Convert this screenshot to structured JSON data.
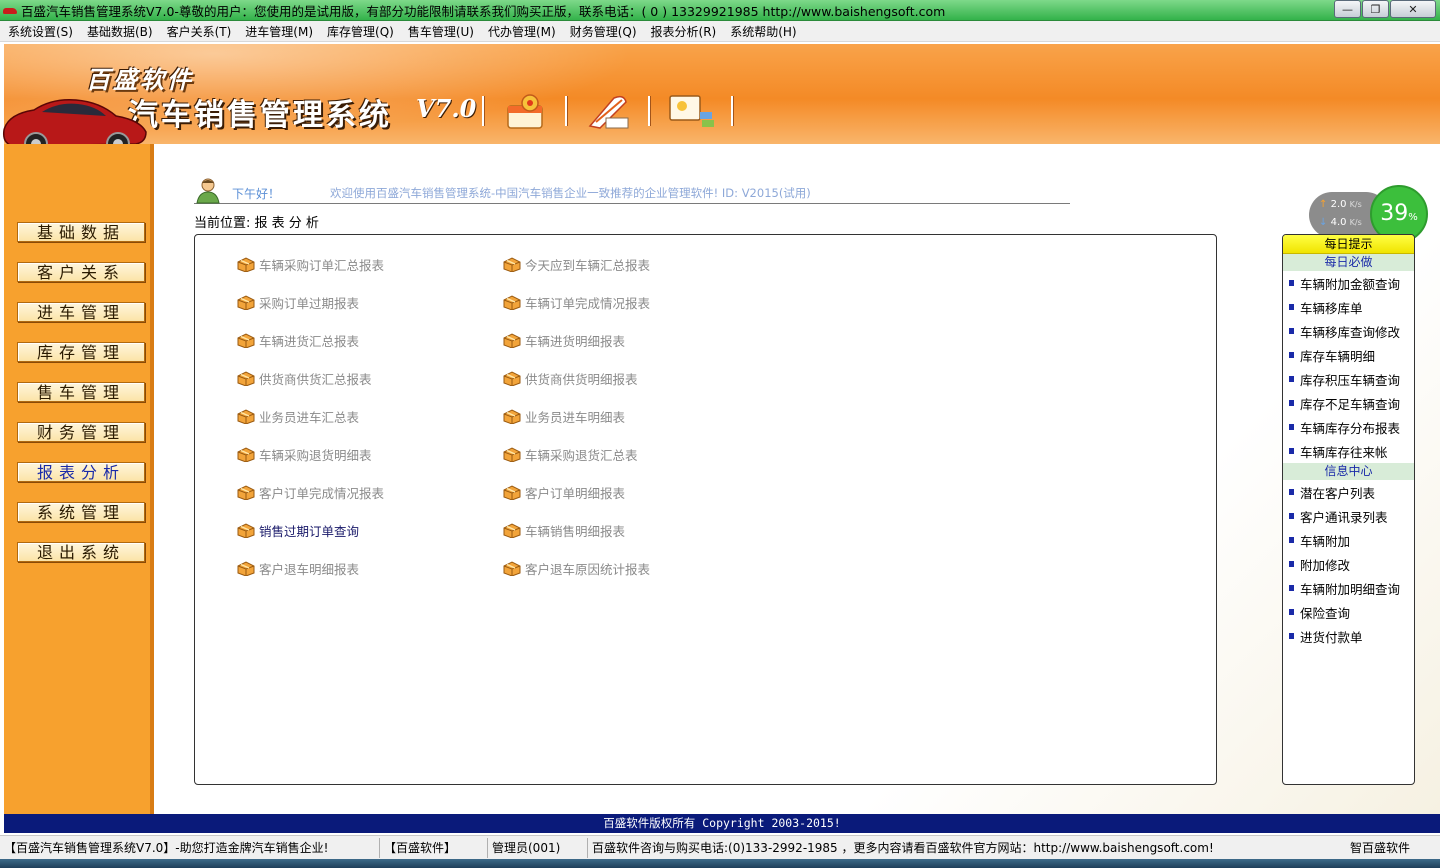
{
  "window": {
    "title": "百盛汽车销售管理系统V7.0-尊敬的用户：您使用的是试用版，有部分功能限制请联系我们购买正版，联系电话：( 0 ) 13329921985  http://www.baishengsoft.com",
    "minimize": "—",
    "restore": "❐",
    "close": "✕"
  },
  "menu": [
    "系统设置(S)",
    "基础数据(B)",
    "客户关系(T)",
    "进车管理(M)",
    "库存管理(Q)",
    "售车管理(U)",
    "代办管理(M)",
    "财务管理(Q)",
    "报表分析(R)",
    "系统帮助(H)"
  ],
  "banner": {
    "company": "百盛软件",
    "app_name": "汽车销售管理系统",
    "version": "V7.0"
  },
  "sidebar": [
    {
      "label": "基础数据",
      "active": false
    },
    {
      "label": "客户关系",
      "active": false
    },
    {
      "label": "进车管理",
      "active": false
    },
    {
      "label": "库存管理",
      "active": false
    },
    {
      "label": "售车管理",
      "active": false
    },
    {
      "label": "财务管理",
      "active": false
    },
    {
      "label": "报表分析",
      "active": true
    },
    {
      "label": "系统管理",
      "active": false
    },
    {
      "label": "退出系统",
      "active": false
    }
  ],
  "greeting": {
    "hello": "下午好！",
    "message": "欢迎使用百盛汽车销售管理系统-中国汽车销售企业一致推荐的企业管理软件! ID: V2015(试用)"
  },
  "location": "当前位置: 报 表 分 析",
  "reports_left": [
    "车辆采购订单汇总报表",
    "采购订单过期报表",
    "车辆进货汇总报表",
    "供货商供货汇总报表",
    "业务员进车汇总表",
    "车辆采购退货明细表",
    "客户订单完成情况报表",
    "销售过期订单查询",
    "客户退车明细报表"
  ],
  "reports_right": [
    "今天应到车辆汇总报表",
    "车辆订单完成情况报表",
    "车辆进货明细报表",
    "供货商供货明细报表",
    "业务员进车明细表",
    "车辆采购退货汇总表",
    "客户订单明细报表",
    "车辆销售明细报表",
    "客户退车原因统计报表"
  ],
  "highlight_report": "销售过期订单查询",
  "right_panel": {
    "header": "每日提示",
    "section1": "每日必做",
    "items1": [
      "车辆附加金额查询",
      "车辆移库单",
      "车辆移库查询修改",
      "库存车辆明细",
      "库存积压车辆查询",
      "库存不足车辆查询",
      "车辆库存分布报表",
      "车辆库存往来帐"
    ],
    "section2": "信息中心",
    "items2": [
      "潜在客户列表",
      "客户通讯录列表",
      "车辆附加",
      "附加修改",
      "车辆附加明细查询",
      "保险查询",
      "进货付款单"
    ]
  },
  "network": {
    "up": "2.0",
    "down": "4.0",
    "unit": "K/s",
    "percent": "39",
    "percent_sign": "%"
  },
  "copyright": "百盛软件版权所有 Copyright 2003-2015!",
  "statusbar": {
    "app": "【百盛汽车销售管理系统V7.0】-助您打造金牌汽车销售企业!",
    "brand": "【百盛软件】",
    "user": "管理员(001)",
    "contact": "百盛软件咨询与购买电话:(0)133-2992-1985 ，更多内容请看百盛软件官方网站：http://www.baishengsoft.com!",
    "right": "智百盛软件"
  },
  "colors": {
    "accent_orange": "#f48a26",
    "sidebar_orange": "#f7a12e",
    "copyright_blue": "#0a1a7a",
    "titlebar_green": "#33b24a"
  }
}
